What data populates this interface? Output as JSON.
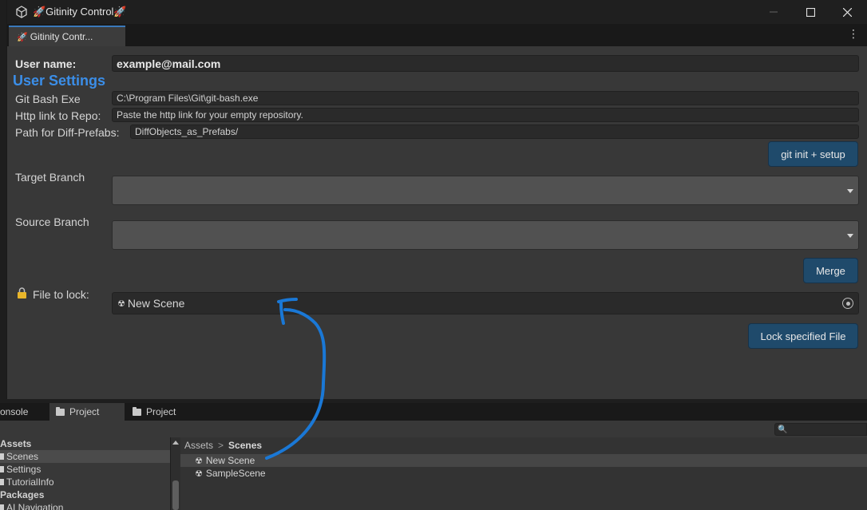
{
  "window": {
    "title": "🚀Gitinity Control🚀",
    "tab_label": "Gitinity Contr...",
    "icons": {
      "app": "unity-cube-icon",
      "tab": "rocket-icon",
      "menu": "kebab-menu-icon"
    }
  },
  "form": {
    "user_name_label": "User name:",
    "user_name_value": "example@mail.com",
    "section_title": "User Settings",
    "git_bash_label": "Git Bash Exe",
    "git_bash_value": "C:\\Program Files\\Git\\git-bash.exe",
    "http_link_label": "Http link to Repo:",
    "http_link_value": "Paste the http link for your empty repository.",
    "diff_path_label": "Path for Diff-Prefabs:",
    "diff_path_value": "DiffObjects_as_Prefabs/",
    "git_init_button": "git init + setup",
    "target_branch_label": "Target Branch",
    "source_branch_label": "Source Branch",
    "merge_button": "Merge",
    "file_lock_label": "File to lock:",
    "file_lock_value": "New Scene",
    "lock_button": "Lock specified File"
  },
  "project_panel": {
    "tabs": [
      {
        "label": "onsole"
      },
      {
        "label": "Project"
      },
      {
        "label": "Project"
      }
    ],
    "tree": [
      {
        "label": "Assets",
        "header": true
      },
      {
        "label": "Scenes",
        "selected": true
      },
      {
        "label": "Settings"
      },
      {
        "label": "TutorialInfo"
      },
      {
        "label": "Packages",
        "header": true
      },
      {
        "label": "AI Navigation"
      }
    ],
    "breadcrumb": {
      "root": "Assets",
      "separator": ">",
      "current": "Scenes"
    },
    "files": [
      {
        "label": "New Scene",
        "selected": true
      },
      {
        "label": "SampleScene"
      }
    ]
  },
  "colors": {
    "accent_blue": "#3b8ee8",
    "button_blue": "#1f4a6b",
    "annotation_arrow": "#1a78d6"
  }
}
